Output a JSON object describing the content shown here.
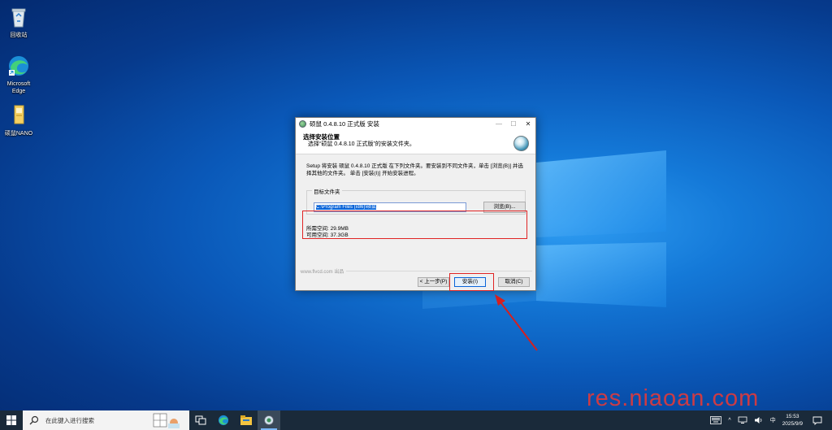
{
  "desktop": {
    "icons": [
      {
        "label": "回收站",
        "icon": "recycle-bin-icon"
      },
      {
        "label": "Microsoft Edge",
        "icon": "edge-icon"
      },
      {
        "label": "硕鼠NANO",
        "icon": "folder-icon"
      }
    ]
  },
  "installer": {
    "window_title": "硕鼠 0.4.8.10 正式版 安装",
    "header_title": "选择安装位置",
    "header_subtitle": "选择“硕鼠 0.4.8.10 正式版”的安装文件夹。",
    "description": "Setup 将安装 硕鼠 0.4.8.10 正式版 在下列文件夹。要安装到不同文件夹，单击 [浏览(B)] 并选择其他的文件夹。 单击 [安装(I)] 开始安装进程。",
    "folder_group_label": "目标文件夹",
    "install_path": "C:\\Program Files (x86)\\硕鼠",
    "browse_label": "浏览(B)...",
    "space_required": "所需空间: 29.9MB",
    "space_available": "可用空间: 37.3GB",
    "branding": "www.flvcd.com 出品",
    "back_label": "< 上一步(P)",
    "install_label": "安装(I)",
    "cancel_label": "取消(C)",
    "minimize_glyph": "—",
    "maximize_glyph": "☐",
    "close_glyph": "✕"
  },
  "taskbar": {
    "search_placeholder": "在此键入进行搜索",
    "ime_label": "中",
    "time": "15:53",
    "date": "2025/9/9"
  },
  "watermark": "res.niaoan.com",
  "colors": {
    "highlight": "#e02424",
    "accent": "#0a64d8"
  }
}
